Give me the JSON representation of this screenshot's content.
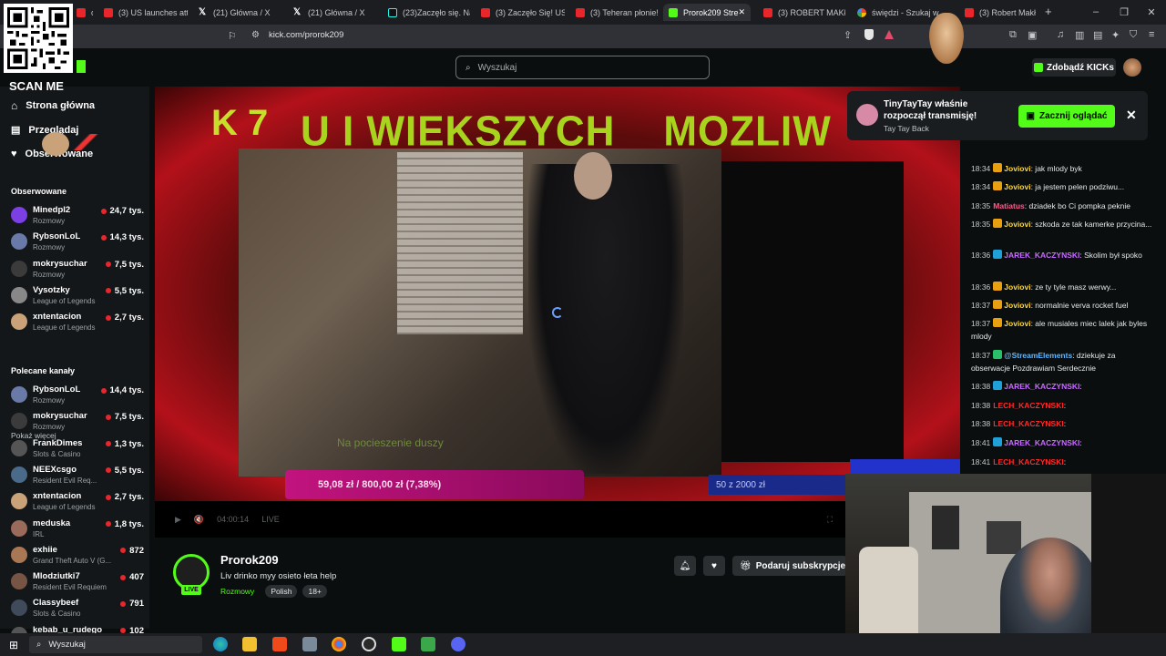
{
  "browser": {
    "tabs": [
      {
        "label": "om",
        "icon": "yt"
      },
      {
        "label": "(3) US launches atta",
        "icon": "yt"
      },
      {
        "label": "(21) Główna / X",
        "icon": "x"
      },
      {
        "label": "(21) Główna / X",
        "icon": "x"
      },
      {
        "label": "(23)Zaczęło się. Naj",
        "icon": "tiktok"
      },
      {
        "label": "(3) Zaczęło Się! USA",
        "icon": "yt"
      },
      {
        "label": "(3) Teheran płonie!",
        "icon": "yt"
      },
      {
        "label": "Prorok209 Stre",
        "icon": "kick",
        "active": true
      },
      {
        "label": "(3) ROBERT MAKŁO",
        "icon": "yt"
      },
      {
        "label": "świędzi - Szukaj w",
        "icon": "google"
      },
      {
        "label": "(3) Robert Makł",
        "icon": "yt"
      }
    ],
    "new_tab": "+",
    "url": "kick.com/prorok209"
  },
  "overlay": {
    "scan_me": "SCAN ME"
  },
  "kick": {
    "search_placeholder": "Wyszukaj",
    "kicks_button": "Zdobądź KICKs",
    "nav": [
      {
        "label": "Strona główna",
        "icon": "home-icon"
      },
      {
        "label": "Przeglądaj",
        "icon": "browse-icon"
      },
      {
        "label": "Obserwowane",
        "icon": "heart-icon"
      }
    ],
    "followed_title": "Obserwowane",
    "followed": [
      {
        "name": "Minedpl2",
        "category": "Rozmowy",
        "viewers": "24,7 tys.",
        "color": "#7b3fe4"
      },
      {
        "name": "RybsonLoL",
        "category": "Rozmowy",
        "viewers": "14,3 tys.",
        "color": "#6a7aa8"
      },
      {
        "name": "mokrysuchar",
        "category": "Rozmowy",
        "viewers": "7,5 tys.",
        "color": "#3b3b3b"
      },
      {
        "name": "Vysotzky",
        "category": "League of Legends",
        "viewers": "5,5 tys.",
        "color": "#888"
      },
      {
        "name": "xntentacion",
        "category": "League of Legends",
        "viewers": "2,7 tys.",
        "color": "#c9a27a"
      }
    ],
    "show_more": "Pokaż więcej",
    "recommended_title": "Polecane kanały",
    "recommended": [
      {
        "name": "RybsonLoL",
        "category": "Rozmowy",
        "viewers": "14,4 tys.",
        "color": "#6a7aa8"
      },
      {
        "name": "mokrysuchar",
        "category": "Rozmowy",
        "viewers": "7,5 tys.",
        "color": "#3b3b3b"
      },
      {
        "name": "FrankDimes",
        "category": "Slots & Casino",
        "viewers": "1,3 tys.",
        "color": "#555"
      },
      {
        "name": "NEEXcsgo",
        "category": "Resident Evil Req...",
        "viewers": "5,5 tys.",
        "color": "#4a6a8a"
      },
      {
        "name": "xntentacion",
        "category": "League of Legends",
        "viewers": "2,7 tys.",
        "color": "#c9a27a"
      },
      {
        "name": "meduska",
        "category": "IRL",
        "viewers": "1,8 tys.",
        "color": "#9a6a5a"
      },
      {
        "name": "exhiie",
        "category": "Grand Theft Auto V (G...",
        "viewers": "872",
        "color": "#aa7755"
      },
      {
        "name": "Mlodziutki7",
        "category": "Resident Evil Requiem",
        "viewers": "407",
        "color": "#775544"
      },
      {
        "name": "Classybeef",
        "category": "Slots & Casino",
        "viewers": "791",
        "color": "#3f4a5a"
      },
      {
        "name": "kebab_u_rudego",
        "category": "",
        "viewers": "102",
        "color": "#555"
      }
    ]
  },
  "video": {
    "banner": "U I WIEKSZYCH    MOZLIW",
    "banner_logo": "K 7",
    "subtitle": "Na pocieszenie duszy",
    "goal_left": "59,08 zł / 800,00 zł (7,38%)",
    "goal_right": "50 z 2000 zł",
    "time": "04:00:14",
    "live_label": "LIVE"
  },
  "stream": {
    "name": "Prorok209",
    "title": "Liv drinko  myy osieto  łeta help",
    "category": "Rozmowy",
    "tags": [
      "Polish",
      "18+"
    ],
    "live_badge": "LIVE",
    "subscribe_label": "Podaruj subskrypcje"
  },
  "notification": {
    "text": "TinyTayTay właśnie rozpoczął transmisję!",
    "sub": "Tay Tay Back",
    "button": "Zacznij oglądać",
    "close": "✕"
  },
  "chat": [
    {
      "time": "18:34",
      "user": "Joviovi",
      "color": "yel",
      "badge": "#e8a010",
      "text": ": jak mlody byk"
    },
    {
      "time": "18:34",
      "user": "Joviovi",
      "color": "yel",
      "badge": "#e8a010",
      "text": ": ja jestem pelen podziwu..."
    },
    {
      "time": "18:35",
      "user": "Matiatus",
      "color": "pink",
      "badge": "",
      "text": ": dziadek bo Ci pompka peknie"
    },
    {
      "time": "18:35",
      "user": "Joviovi",
      "color": "yel",
      "badge": "#e8a010",
      "text": ": szkoda ze tak kamerke przycina..."
    },
    {
      "time": "18:36",
      "user": "JAREK_KACZYNSKI",
      "color": "purp",
      "badge": "#1fa0d8",
      "text": ": Skolim był spoko"
    },
    {
      "time": "18:36",
      "user": "Joviovi",
      "color": "yel",
      "badge": "#e8a010",
      "text": ": ze ty tyle masz werwy..."
    },
    {
      "time": "18:37",
      "user": "Joviovi",
      "color": "yel",
      "badge": "#e8a010",
      "text": ": normalnie verva rocket fuel"
    },
    {
      "time": "18:37",
      "user": "Joviovi",
      "color": "yel",
      "badge": "#e8a010",
      "text": ": ale musiales miec lalek jak byles mlody"
    },
    {
      "time": "18:37",
      "user": "@StreamElements",
      "color": "blue",
      "badge": "#2ac06a",
      "text": ": dziekuje za obserwacje Pozdrawiam Serdecznie"
    },
    {
      "time": "18:38",
      "user": "JAREK_KACZYNSKI",
      "color": "purp",
      "badge": "#1fa0d8",
      "text": ":"
    },
    {
      "time": "18:38",
      "user": "LECH_KACZYNSKI",
      "color": "red",
      "badge": "",
      "text": ":"
    },
    {
      "time": "18:38",
      "user": "LECH_KACZYNSKI",
      "color": "red",
      "badge": "",
      "text": ":"
    },
    {
      "time": "18:41",
      "user": "JAREK_KACZYNSKI",
      "color": "purp",
      "badge": "#1fa0d8",
      "text": ":"
    },
    {
      "time": "18:41",
      "user": "LECH_KACZYNSKI",
      "color": "red",
      "badge": "",
      "text": ":"
    }
  ],
  "taskbar": {
    "search": "Wyszukaj"
  }
}
